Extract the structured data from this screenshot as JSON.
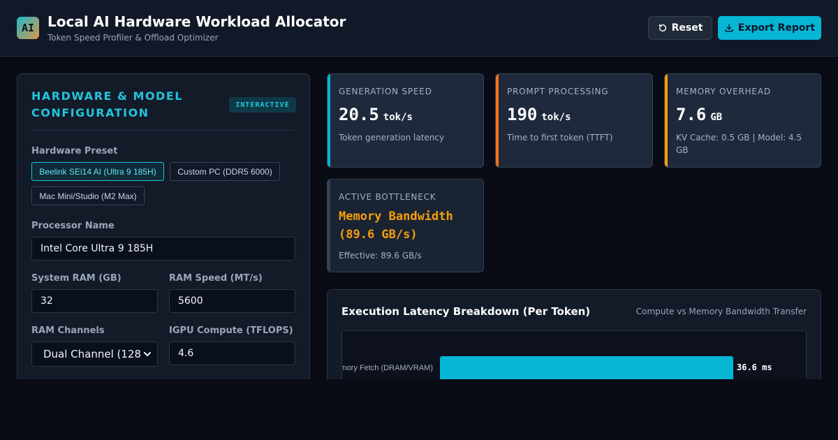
{
  "header": {
    "logo_text": "AI",
    "title": "Local AI Hardware Workload Allocator",
    "subtitle": "Token Speed Profiler & Offload Optimizer",
    "reset_label": "Reset",
    "export_label": "Export Report"
  },
  "config": {
    "title": "HARDWARE & MODEL CONFIGURATION",
    "badge": "INTERACTIVE",
    "preset_label": "Hardware Preset",
    "presets": [
      {
        "label": "Beelink SEi14 AI (Ultra 9 185H)",
        "active": true
      },
      {
        "label": "Custom PC (DDR5 6000)",
        "active": false
      },
      {
        "label": "Mac Mini/Studio (M2 Max)",
        "active": false
      }
    ],
    "processor_label": "Processor Name",
    "processor_value": "Intel Core Ultra 9 185H",
    "ram_label": "System RAM (GB)",
    "ram_value": "32",
    "ram_speed_label": "RAM Speed (MT/s)",
    "ram_speed_value": "5600",
    "channels_label": "RAM Channels",
    "channels_value": "Dual Channel (128-",
    "igpu_label": "IGPU Compute (TFLOPS)",
    "igpu_value": "4.6"
  },
  "stats": {
    "gen": {
      "label": "GENERATION SPEED",
      "value": "20.5",
      "unit": "tok/s",
      "desc": "Token generation latency",
      "color": "#06b6d4"
    },
    "prompt": {
      "label": "PROMPT PROCESSING",
      "value": "190",
      "unit": "tok/s",
      "desc": "Time to first token (TTFT)",
      "color": "#f97316"
    },
    "memory": {
      "label": "MEMORY OVERHEAD",
      "value": "7.6",
      "unit": "GB",
      "desc": "KV Cache: 0.5 GB | Model: 4.5 GB",
      "color": "#f59e0b"
    },
    "bottleneck": {
      "label": "ACTIVE BOTTLENECK",
      "value": "Memory Bandwidth (89.6 GB/s)",
      "desc": "Effective: 89.6 GB/s",
      "color": "#f59e0b"
    }
  },
  "chart": {
    "title": "Execution Latency Breakdown (Per Token)",
    "subtitle": "Compute vs Memory Bandwidth Transfer"
  },
  "chart_data": {
    "type": "bar",
    "orientation": "horizontal",
    "categories": [
      "Memory Fetch (DRAM/VRAM)"
    ],
    "values": [
      36.6
    ],
    "value_labels": [
      "36.6 ms"
    ],
    "bar_color": "#06b6d4"
  }
}
